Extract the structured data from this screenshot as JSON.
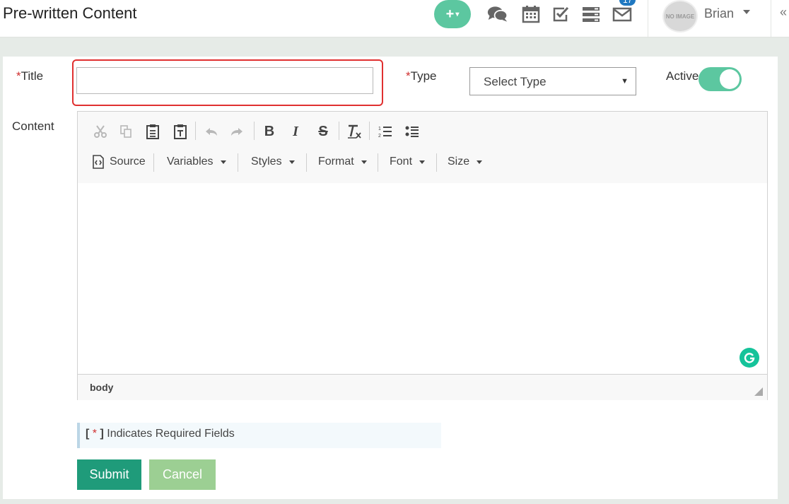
{
  "header": {
    "page_title": "Pre-written Content",
    "add_button_label": "+",
    "notification_count": "17",
    "avatar_text": "NO IMAGE",
    "user_name": "Brian",
    "collapse_label": "«"
  },
  "form": {
    "title_label": "Title",
    "title_value": "",
    "type_label": "Type",
    "type_selected": "Select Type",
    "active_label": "Active",
    "active_on": true,
    "content_label": "Content",
    "required_marker": "*"
  },
  "editor": {
    "toolbar_icons": [
      "cut-icon",
      "copy-icon",
      "paste-icon",
      "paste-text-icon",
      "undo-icon",
      "redo-icon",
      "bold-icon",
      "italic-icon",
      "strikethrough-icon",
      "remove-format-icon",
      "numbered-list-icon",
      "bulleted-list-icon"
    ],
    "source_label": "Source",
    "dropdowns": [
      "Variables",
      "Styles",
      "Format",
      "Font",
      "Size"
    ],
    "path_label": "body"
  },
  "note": {
    "bracket_open": "[",
    "star": "*",
    "bracket_close": "]",
    "text": "Indicates Required Fields"
  },
  "buttons": {
    "submit": "Submit",
    "cancel": "Cancel"
  },
  "colors": {
    "accent": "#5cc7a0",
    "submit": "#1f9b7a",
    "cancel": "#9ccf93",
    "required": "#d03030",
    "badge": "#1f78c1"
  }
}
